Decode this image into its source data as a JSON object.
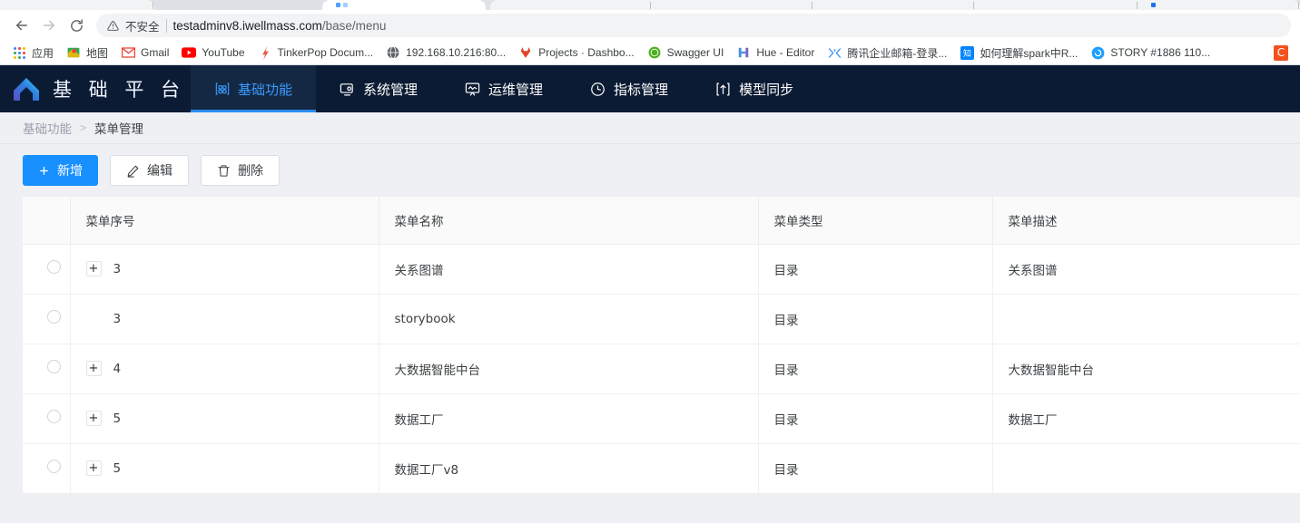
{
  "browser": {
    "address": {
      "security_label": "不安全",
      "url_bold": "testadminv8.iwellmass.com",
      "url_path": "/base/menu",
      "url_full": "testadminv8.iwellmass.com/base/menu"
    },
    "nav": {
      "back_label": "←",
      "forward_label": "→",
      "reload_label": "⟳"
    },
    "bookmarks": [
      {
        "label": "应用",
        "icon": "apps-grid-icon",
        "color": "#4285f4"
      },
      {
        "label": "地图",
        "icon": "maps-icon",
        "color": "#34a853"
      },
      {
        "label": "Gmail",
        "icon": "gmail-icon",
        "color": "#ea4335"
      },
      {
        "label": "YouTube",
        "icon": "youtube-icon",
        "color": "#ff0000"
      },
      {
        "label": "TinkerPop Docum...",
        "icon": "tinkerpop-icon",
        "color": "#e8573f"
      },
      {
        "label": "192.168.10.216:80...",
        "icon": "globe-icon",
        "color": "#5f6368"
      },
      {
        "label": "Projects · Dashbo...",
        "icon": "gitlab-icon",
        "color": "#e24329"
      },
      {
        "label": "Swagger UI",
        "icon": "swagger-icon",
        "color": "#85ea2d"
      },
      {
        "label": "Hue - Editor",
        "icon": "hue-icon",
        "color": "#4a90d9"
      },
      {
        "label": "腾讯企业邮箱-登录...",
        "icon": "tencent-mail-icon",
        "color": "#2d8cf0"
      },
      {
        "label": "如何理解spark中R...",
        "icon": "zhihu-icon",
        "color": "#0084ff"
      },
      {
        "label": "STORY #1886 110...",
        "icon": "story-icon",
        "color": "#1e9fff"
      },
      {
        "label": "",
        "icon": "c-icon",
        "color": "#f4511e"
      }
    ]
  },
  "app": {
    "brand": "基 础 平 台",
    "nav_items": [
      {
        "label": "基础功能",
        "icon": "grid-app-icon",
        "active": true
      },
      {
        "label": "系统管理",
        "icon": "monitor-gear-icon",
        "active": false
      },
      {
        "label": "运维管理",
        "icon": "monitor-wave-icon",
        "active": false
      },
      {
        "label": "指标管理",
        "icon": "clock-icon",
        "active": false
      },
      {
        "label": "模型同步",
        "icon": "upload-box-icon",
        "active": false
      }
    ],
    "accent_color": "#2b8cf0",
    "header_bg": "#0b1b33"
  },
  "breadcrumb": {
    "parent": "基础功能",
    "separator": ">",
    "current": "菜单管理"
  },
  "toolbar": {
    "add_label": "新增",
    "add_icon": "plus-icon",
    "edit_label": "编辑",
    "edit_icon": "pencil-icon",
    "delete_label": "删除",
    "delete_icon": "trash-icon"
  },
  "table": {
    "columns": [
      "",
      "菜单序号",
      "菜单名称",
      "菜单类型",
      "菜单描述"
    ],
    "rows": [
      {
        "expandable": true,
        "seq": "3",
        "name": "关系图谱",
        "type": "目录",
        "desc": "关系图谱"
      },
      {
        "expandable": false,
        "seq": "3",
        "name": "storybook",
        "type": "目录",
        "desc": ""
      },
      {
        "expandable": true,
        "seq": "4",
        "name": "大数据智能中台",
        "type": "目录",
        "desc": "大数据智能中台"
      },
      {
        "expandable": true,
        "seq": "5",
        "name": "数据工厂",
        "type": "目录",
        "desc": "数据工厂"
      },
      {
        "expandable": true,
        "seq": "5",
        "name": "数据工厂v8",
        "type": "目录",
        "desc": ""
      }
    ],
    "expand_glyph": "+"
  }
}
